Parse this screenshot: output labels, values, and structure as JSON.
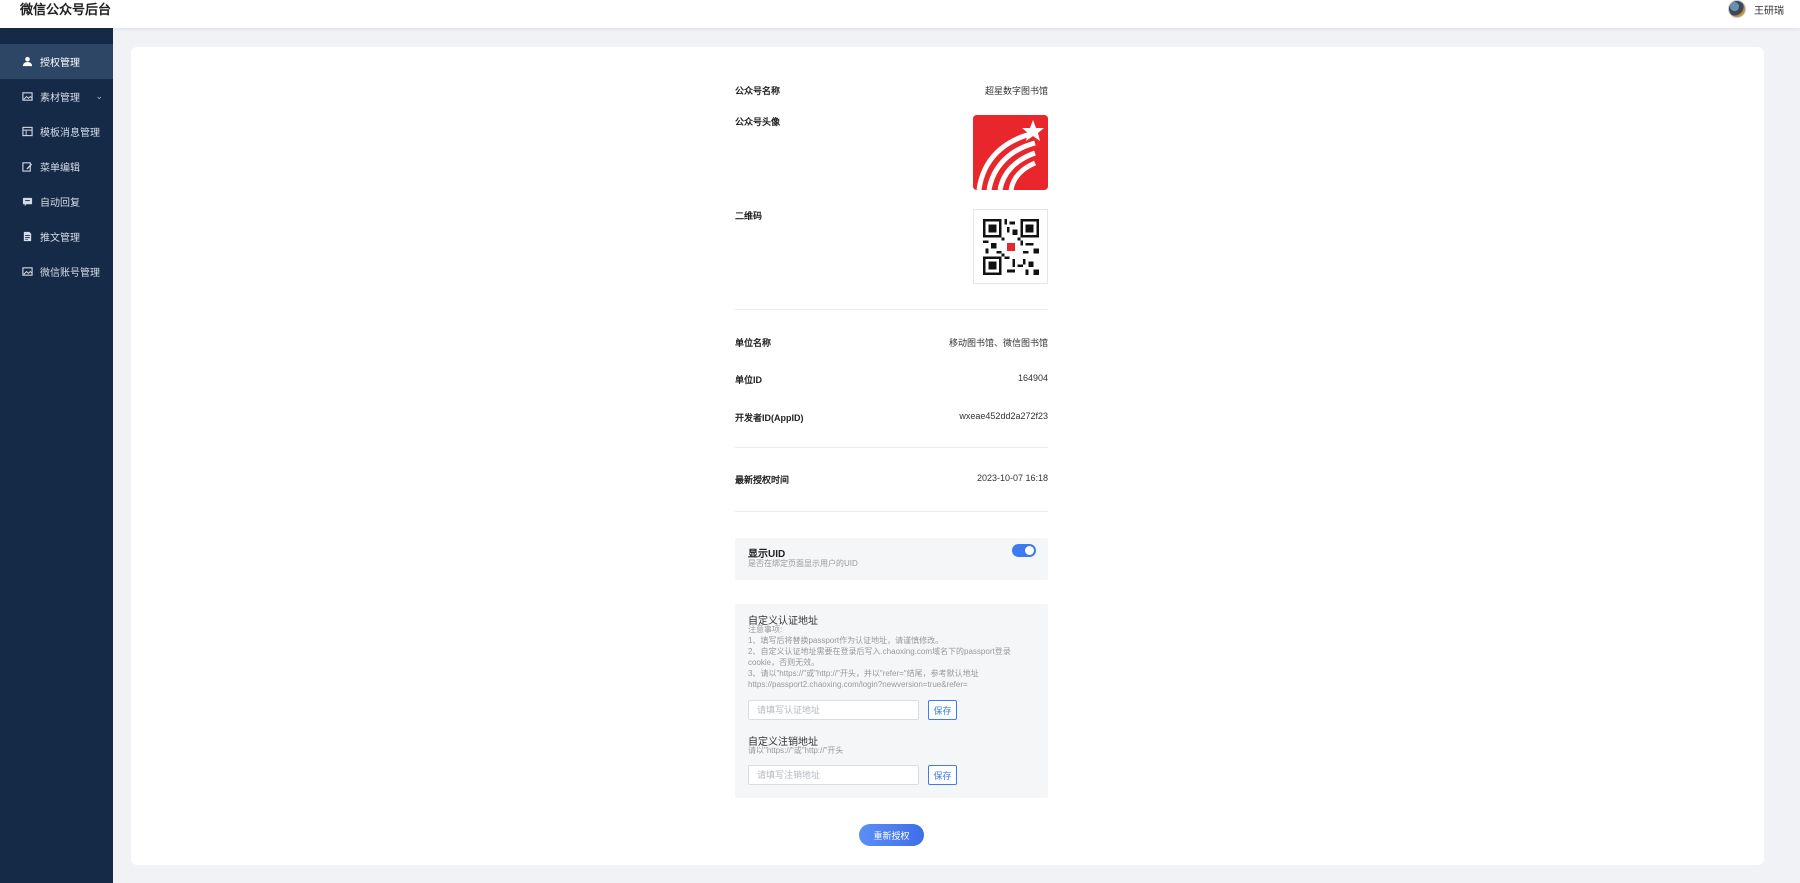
{
  "header": {
    "title": "微信公众号后台",
    "user_name": "王研瑞"
  },
  "sidebar": {
    "items": [
      {
        "label": "授权管理",
        "icon": "user-icon",
        "active": true
      },
      {
        "label": "素材管理",
        "icon": "image-icon",
        "has_submenu": true
      },
      {
        "label": "模板消息管理",
        "icon": "template-icon"
      },
      {
        "label": "菜单编辑",
        "icon": "edit-icon"
      },
      {
        "label": "自动回复",
        "icon": "reply-icon"
      },
      {
        "label": "推文管理",
        "icon": "article-icon"
      },
      {
        "label": "微信账号管理",
        "icon": "account-icon"
      }
    ]
  },
  "account": {
    "name_label": "公众号名称",
    "name_value": "超星数字图书馆",
    "avatar_label": "公众号头像",
    "qr_label": "二维码",
    "org_name_label": "单位名称",
    "org_name_value": "移动图书馆、微信图书馆",
    "org_id_label": "单位ID",
    "org_id_value": "164904",
    "appid_label": "开发者ID(AppID)",
    "appid_value": "wxeae452dd2a272f23",
    "auth_time_label": "最新授权时间",
    "auth_time_value": "2023-10-07 16:18"
  },
  "uid_setting": {
    "title": "显示UID",
    "desc": "是否在绑定页面显示用户的UID",
    "enabled": true
  },
  "custom_urls": {
    "auth_title": "自定义认证地址",
    "auth_notes": [
      "注意事项:",
      "1、填写后将替换passport作为认证地址，请谨慎修改。",
      "2、自定义认证地址需要在登录后写入.chaoxing.com域名下的passport登录cookie，否则无效。",
      "3、请以\"https://\"或\"http://\"开头，并以\"refer=\"结尾，参考默认地址https://passport2.chaoxing.com/login?newversion=true&refer="
    ],
    "auth_placeholder": "请填写认证地址",
    "auth_save": "保存",
    "logout_title": "自定义注销地址",
    "logout_note": "请以\"https://\"或\"http://\"开头",
    "logout_placeholder": "请填写注销地址",
    "logout_save": "保存"
  },
  "reauth_button": "重新授权",
  "colors": {
    "sidebar_bg": "#152a47",
    "sidebar_active": "#2d4666",
    "accent": "#3e7bf0"
  }
}
